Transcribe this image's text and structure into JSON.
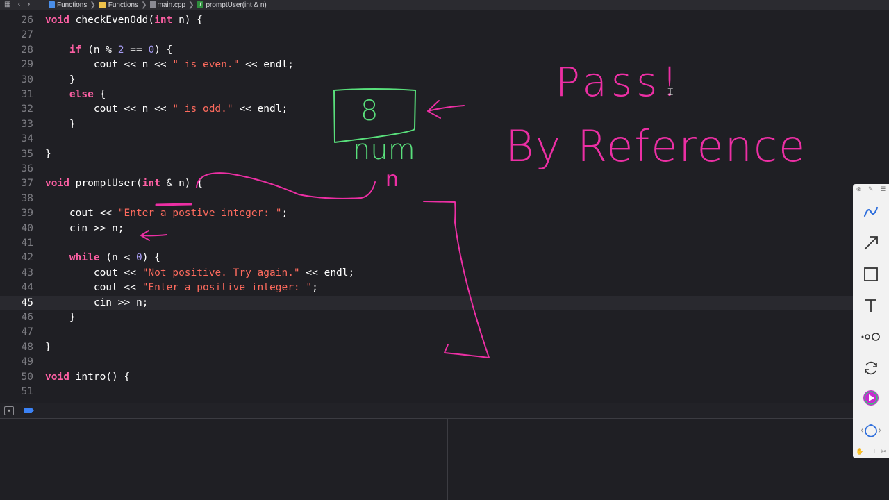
{
  "breadcrumb": {
    "items": [
      "Functions",
      "Functions",
      "main.cpp",
      "promptUser(int & n)"
    ],
    "separator": "❯"
  },
  "editor": {
    "current_line": 45,
    "lines": [
      {
        "n": "26",
        "tokens": [
          {
            "t": "void",
            "c": "kw"
          },
          {
            "t": " checkEvenOdd(",
            "c": "pl"
          },
          {
            "t": "int",
            "c": "kw"
          },
          {
            "t": " n) {",
            "c": "pl"
          }
        ]
      },
      {
        "n": "27",
        "tokens": []
      },
      {
        "n": "28",
        "tokens": [
          {
            "t": "    ",
            "c": "pl"
          },
          {
            "t": "if",
            "c": "kw"
          },
          {
            "t": " (n % ",
            "c": "pl"
          },
          {
            "t": "2",
            "c": "num"
          },
          {
            "t": " == ",
            "c": "pl"
          },
          {
            "t": "0",
            "c": "num"
          },
          {
            "t": ") {",
            "c": "pl"
          }
        ]
      },
      {
        "n": "29",
        "tokens": [
          {
            "t": "        cout << n << ",
            "c": "pl"
          },
          {
            "t": "\" is even.\"",
            "c": "str"
          },
          {
            "t": " << endl;",
            "c": "pl"
          }
        ]
      },
      {
        "n": "30",
        "tokens": [
          {
            "t": "    }",
            "c": "pl"
          }
        ]
      },
      {
        "n": "31",
        "tokens": [
          {
            "t": "    ",
            "c": "pl"
          },
          {
            "t": "else",
            "c": "kw"
          },
          {
            "t": " {",
            "c": "pl"
          }
        ]
      },
      {
        "n": "32",
        "tokens": [
          {
            "t": "        cout << n << ",
            "c": "pl"
          },
          {
            "t": "\" is odd.\"",
            "c": "str"
          },
          {
            "t": " << endl;",
            "c": "pl"
          }
        ]
      },
      {
        "n": "33",
        "tokens": [
          {
            "t": "    }",
            "c": "pl"
          }
        ]
      },
      {
        "n": "34",
        "tokens": []
      },
      {
        "n": "35",
        "tokens": [
          {
            "t": "}",
            "c": "pl"
          }
        ]
      },
      {
        "n": "36",
        "tokens": []
      },
      {
        "n": "37",
        "tokens": [
          {
            "t": "void",
            "c": "kw"
          },
          {
            "t": " promptUser(",
            "c": "pl"
          },
          {
            "t": "int",
            "c": "kw"
          },
          {
            "t": " & n) {",
            "c": "pl"
          }
        ]
      },
      {
        "n": "38",
        "tokens": []
      },
      {
        "n": "39",
        "tokens": [
          {
            "t": "    cout << ",
            "c": "pl"
          },
          {
            "t": "\"Enter a postive integer: \"",
            "c": "str"
          },
          {
            "t": ";",
            "c": "pl"
          }
        ]
      },
      {
        "n": "40",
        "tokens": [
          {
            "t": "    cin >> n;",
            "c": "pl"
          }
        ]
      },
      {
        "n": "41",
        "tokens": []
      },
      {
        "n": "42",
        "tokens": [
          {
            "t": "    ",
            "c": "pl"
          },
          {
            "t": "while",
            "c": "kw"
          },
          {
            "t": " (n < ",
            "c": "pl"
          },
          {
            "t": "0",
            "c": "num"
          },
          {
            "t": ") {",
            "c": "pl"
          }
        ]
      },
      {
        "n": "43",
        "tokens": [
          {
            "t": "        cout << ",
            "c": "pl"
          },
          {
            "t": "\"Not positive. Try again.\"",
            "c": "str"
          },
          {
            "t": " << endl;",
            "c": "pl"
          }
        ]
      },
      {
        "n": "44",
        "tokens": [
          {
            "t": "        cout << ",
            "c": "pl"
          },
          {
            "t": "\"Enter a positive integer: \"",
            "c": "str"
          },
          {
            "t": ";",
            "c": "pl"
          }
        ]
      },
      {
        "n": "45",
        "tokens": [
          {
            "t": "        cin >> n;",
            "c": "pl"
          }
        ]
      },
      {
        "n": "46",
        "tokens": [
          {
            "t": "    }",
            "c": "pl"
          }
        ]
      },
      {
        "n": "47",
        "tokens": []
      },
      {
        "n": "48",
        "tokens": [
          {
            "t": "}",
            "c": "pl"
          }
        ]
      },
      {
        "n": "49",
        "tokens": []
      },
      {
        "n": "50",
        "tokens": [
          {
            "t": "void",
            "c": "kw"
          },
          {
            "t": " intro() {",
            "c": "pl"
          }
        ]
      },
      {
        "n": "51",
        "tokens": []
      }
    ]
  },
  "annotations": {
    "box_value": "8",
    "box_label": "num",
    "ref_label": "n",
    "title_line1": "Pass!",
    "title_line2": "By Reference"
  },
  "toolbar": {
    "tools": [
      "pen-icon",
      "arrow-icon",
      "rectangle-icon",
      "text-icon",
      "connector-icon",
      "rotate-icon",
      "record-icon",
      "timer-icon"
    ]
  },
  "colors": {
    "ink_pink": "#ec2fa4",
    "ink_green": "#59e07c",
    "keyword": "#fc5fa3",
    "string": "#fc6a5d",
    "number": "#a79df4",
    "background": "#1f1f24"
  }
}
